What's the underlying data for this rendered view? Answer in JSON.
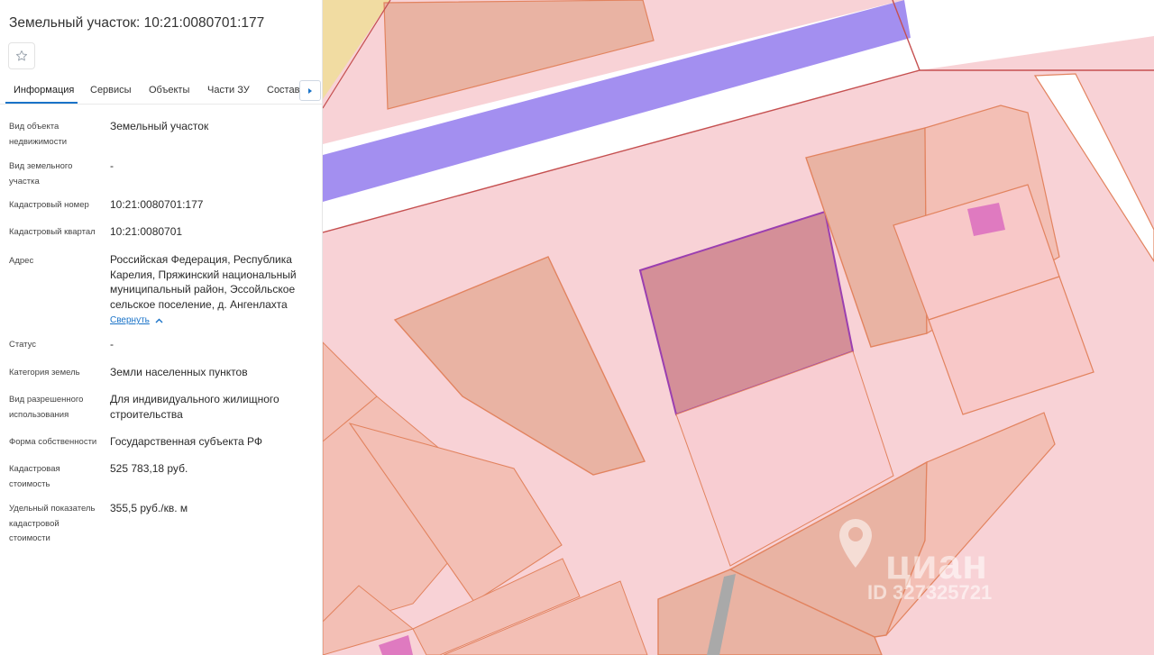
{
  "header": {
    "title": "Земельный участок: 10:21:0080701:177"
  },
  "toolbar": {
    "favorite_icon": "star-icon"
  },
  "tabs": [
    {
      "label": "Информация",
      "active": true
    },
    {
      "label": "Сервисы"
    },
    {
      "label": "Объекты"
    },
    {
      "label": "Части ЗУ"
    },
    {
      "label": "Состав"
    }
  ],
  "info": {
    "rows": [
      {
        "label": "Вид объекта недвижимости",
        "value": "Земельный участок"
      },
      {
        "label": "Вид земельного участка",
        "value": "-"
      },
      {
        "label": "Кадастровый номер",
        "value": "10:21:0080701:177"
      },
      {
        "label": "Кадастровый квартал",
        "value": "10:21:0080701"
      },
      {
        "label": "Адрес",
        "value": "Российская Федерация, Республика Карелия, Пряжинский национальный муниципальный район, Эссойльское сельское поселение, д. Ангенлахта"
      },
      {
        "label": "Статус",
        "value": "-"
      },
      {
        "label": "Категория земель",
        "value": "Земли населенных пунктов"
      },
      {
        "label": "Вид разрешенного использования",
        "value": "Для индивидуального жилищного строительства"
      },
      {
        "label": "Форма собственности",
        "value": "Государственная субъекта РФ"
      },
      {
        "label": "Кадастровая стоимость",
        "value": "525 783,18 руб."
      },
      {
        "label": "Удельный показатель кадастровой стоимости",
        "value": "355,5 руб./кв. м"
      }
    ],
    "collapse_label": "Свернуть"
  },
  "watermark": {
    "brand": "циан",
    "id": "ID 327325721"
  },
  "colors": {
    "accent": "#1a73c8",
    "map_background": "#f8d2d6",
    "parcel_fill": "#e9b3a3",
    "parcel_border": "#e2835f",
    "selected_parcel": "#d48f98",
    "selected_border": "#9b3fb0",
    "road": "#a38ff0",
    "building": "#df7ac0"
  }
}
